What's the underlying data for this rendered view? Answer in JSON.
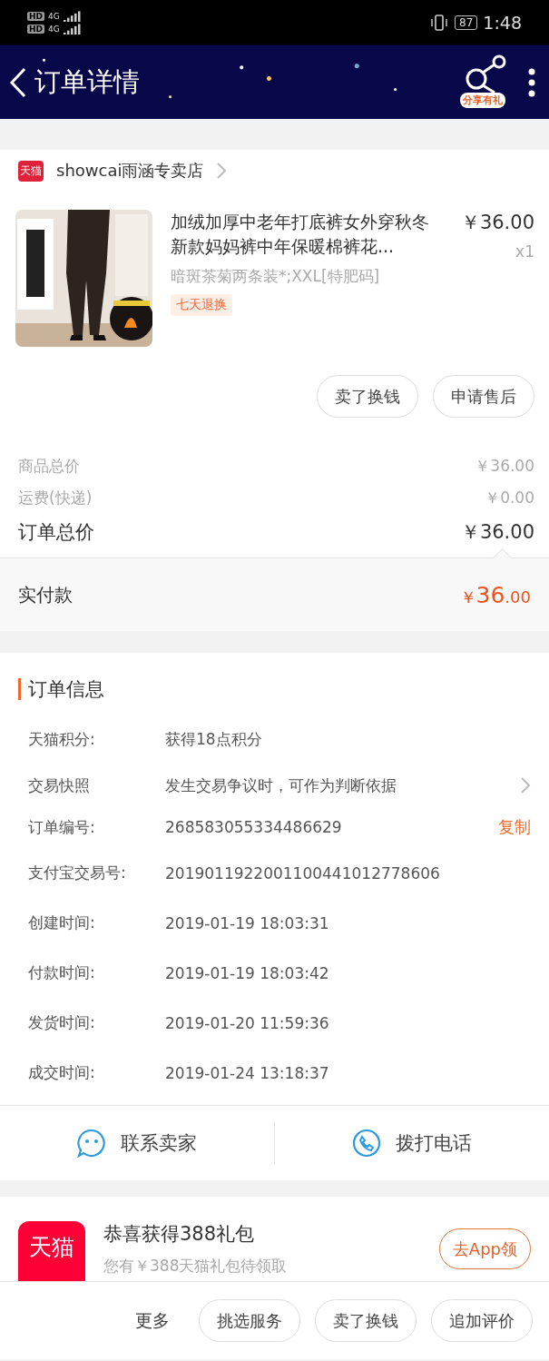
{
  "status_bar": {
    "sims": [
      {
        "badge": "HD",
        "network": "4G"
      },
      {
        "badge": "HD",
        "network": "4G"
      }
    ],
    "battery": "87",
    "time": "1:48"
  },
  "header": {
    "title": "订单详情",
    "share_label": "分享有礼"
  },
  "store": {
    "logo": "天猫",
    "name": "showcai雨涵专卖店"
  },
  "product": {
    "kind": "picture",
    "title": "加绒加厚中老年打底裤女外穿秋冬新款妈妈裤中年保暖棉裤花...",
    "price": "￥36.00",
    "quantity": "x1",
    "variant": "暗斑茶菊两条装*;XXL[特肥码]",
    "tag": "七天退换"
  },
  "product_actions": [
    "卖了换钱",
    "申请售后"
  ],
  "summary": [
    {
      "kind": "minor",
      "label": "商品总价",
      "value": "￥36.00"
    },
    {
      "kind": "minor",
      "label": "运费(快递)",
      "value": "￥0.00"
    },
    {
      "kind": "total",
      "label": "订单总价",
      "value": "￥36.00"
    }
  ],
  "paid": {
    "label": "实付款",
    "currency": "￥",
    "amount": "36",
    "cents": ".00"
  },
  "order_info": {
    "title": "订单信息",
    "rows": [
      {
        "label": "天猫积分:",
        "value": "获得18点积分",
        "action": null,
        "expandable": false
      },
      {
        "label": "交易快照",
        "value": "发生交易争议时，可作为判断依据",
        "action": null,
        "expandable": true
      },
      {
        "label": "订单编号:",
        "value": "268583055334486629",
        "action": "复制",
        "expandable": false
      },
      {
        "label": "支付宝交易号:",
        "value": "2019011922001100441012778606",
        "action": null,
        "expandable": false
      },
      {
        "label": "创建时间:",
        "value": "2019-01-19 18:03:31",
        "action": null,
        "expandable": false
      },
      {
        "label": "付款时间:",
        "value": "2019-01-19 18:03:42",
        "action": null,
        "expandable": false
      },
      {
        "label": "发货时间:",
        "value": "2019-01-20 11:59:36",
        "action": null,
        "expandable": false
      },
      {
        "label": "成交时间:",
        "value": "2019-01-24 13:18:37",
        "action": null,
        "expandable": false
      }
    ]
  },
  "contact": [
    {
      "kind": "chat",
      "label": "联系卖家"
    },
    {
      "kind": "phone",
      "label": "拨打电话"
    }
  ],
  "promo": {
    "logo": "天猫",
    "title": "恭喜获得388礼包",
    "subtitle": "您有￥388天猫礼包待领取",
    "button": "去App领"
  },
  "bottom_bar": {
    "more": "更多",
    "buttons": [
      "挑选服务",
      "卖了换钱",
      "追加评价"
    ]
  }
}
